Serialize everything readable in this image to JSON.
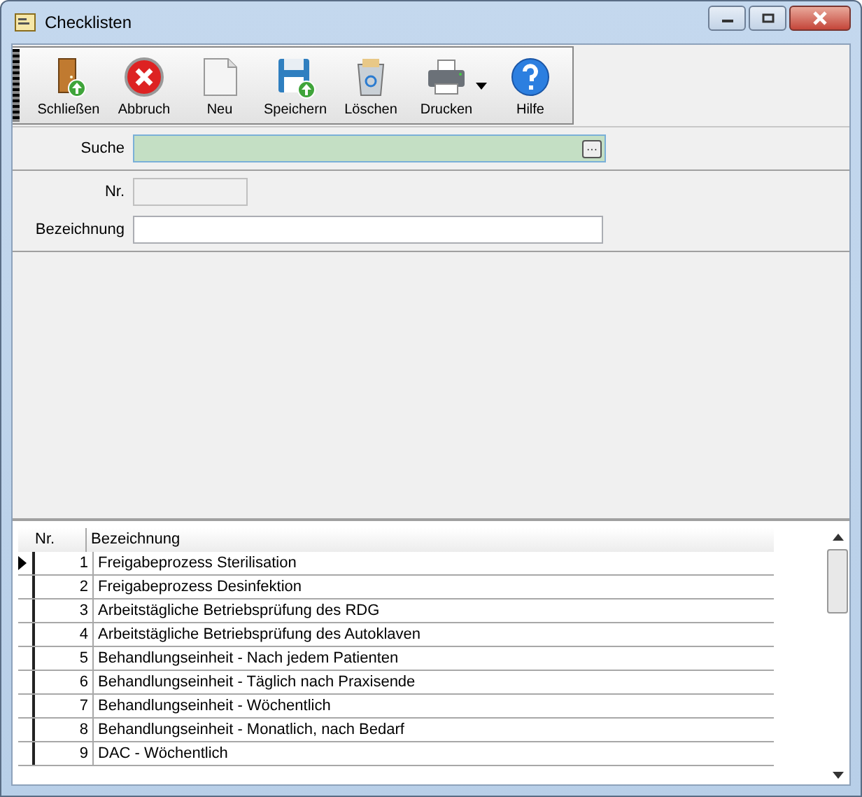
{
  "window": {
    "title": "Checklisten"
  },
  "toolbar": [
    {
      "label": "Schließen",
      "kind": "door"
    },
    {
      "label": "Abbruch",
      "kind": "cancel"
    },
    {
      "label": "Neu",
      "kind": "new"
    },
    {
      "label": "Speichern",
      "kind": "save"
    },
    {
      "label": "Löschen",
      "kind": "trash"
    },
    {
      "label": "Drucken",
      "kind": "print",
      "dropdown": true
    },
    {
      "label": "Hilfe",
      "kind": "help"
    }
  ],
  "search": {
    "label": "Suche",
    "button": "···"
  },
  "form": [
    {
      "label": "Nr.",
      "disabled": true
    },
    {
      "label": "Bezeichnung",
      "disabled": false
    }
  ],
  "table": {
    "columns": [
      "Nr.",
      "Bezeichnung"
    ],
    "rows": [
      {
        "nr": "1",
        "name": "Freigabeprozess Sterilisation",
        "selected": true
      },
      {
        "nr": "2",
        "name": "Freigabeprozess Desinfektion",
        "selected": false
      },
      {
        "nr": "3",
        "name": "Arbeitstägliche Betriebsprüfung des RDG",
        "selected": false
      },
      {
        "nr": "4",
        "name": "Arbeitstägliche Betriebsprüfung des Autoklaven",
        "selected": false
      },
      {
        "nr": "5",
        "name": "Behandlungseinheit - Nach jedem Patienten",
        "selected": false
      },
      {
        "nr": "6",
        "name": "Behandlungseinheit - Täglich nach Praxisende",
        "selected": false
      },
      {
        "nr": "7",
        "name": "Behandlungseinheit - Wöchentlich",
        "selected": false
      },
      {
        "nr": "8",
        "name": "Behandlungseinheit - Monatlich, nach Bedarf",
        "selected": false
      },
      {
        "nr": "9",
        "name": "DAC - Wöchentlich",
        "selected": false
      }
    ]
  }
}
